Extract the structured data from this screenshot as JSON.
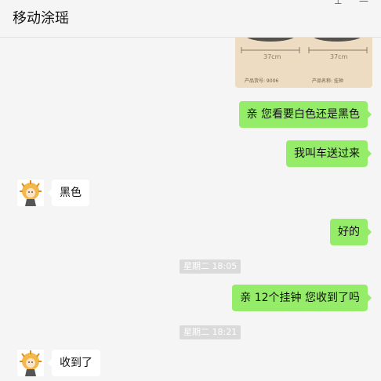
{
  "window": {
    "title": "移动涂瑶",
    "pin_glyph": "⊥",
    "minimize_glyph": "—"
  },
  "product_image": {
    "dim_left": "37cm",
    "dim_right": "37cm",
    "meta_left": "产品货号: 9006",
    "meta_right": "产品名称: 挂钟",
    "background_color": "#eddcc1"
  },
  "messages": [
    {
      "side": "out",
      "text": "亲 您看要白色还是黑色"
    },
    {
      "side": "out",
      "text": "我叫车送过来"
    },
    {
      "side": "in",
      "text": "黑色"
    },
    {
      "side": "out",
      "text": "好的"
    },
    {
      "side": "time",
      "text": "星期二 18:05"
    },
    {
      "side": "out",
      "text": "亲 12个挂钟 您收到了吗"
    },
    {
      "side": "time",
      "text": "星期二 18:21"
    },
    {
      "side": "in",
      "text": "收到了"
    }
  ],
  "colors": {
    "outgoing_bubble": "#95ec69",
    "incoming_bubble": "#ffffff",
    "background": "#f5f5f5",
    "timestamp_bg": "#dadada"
  }
}
